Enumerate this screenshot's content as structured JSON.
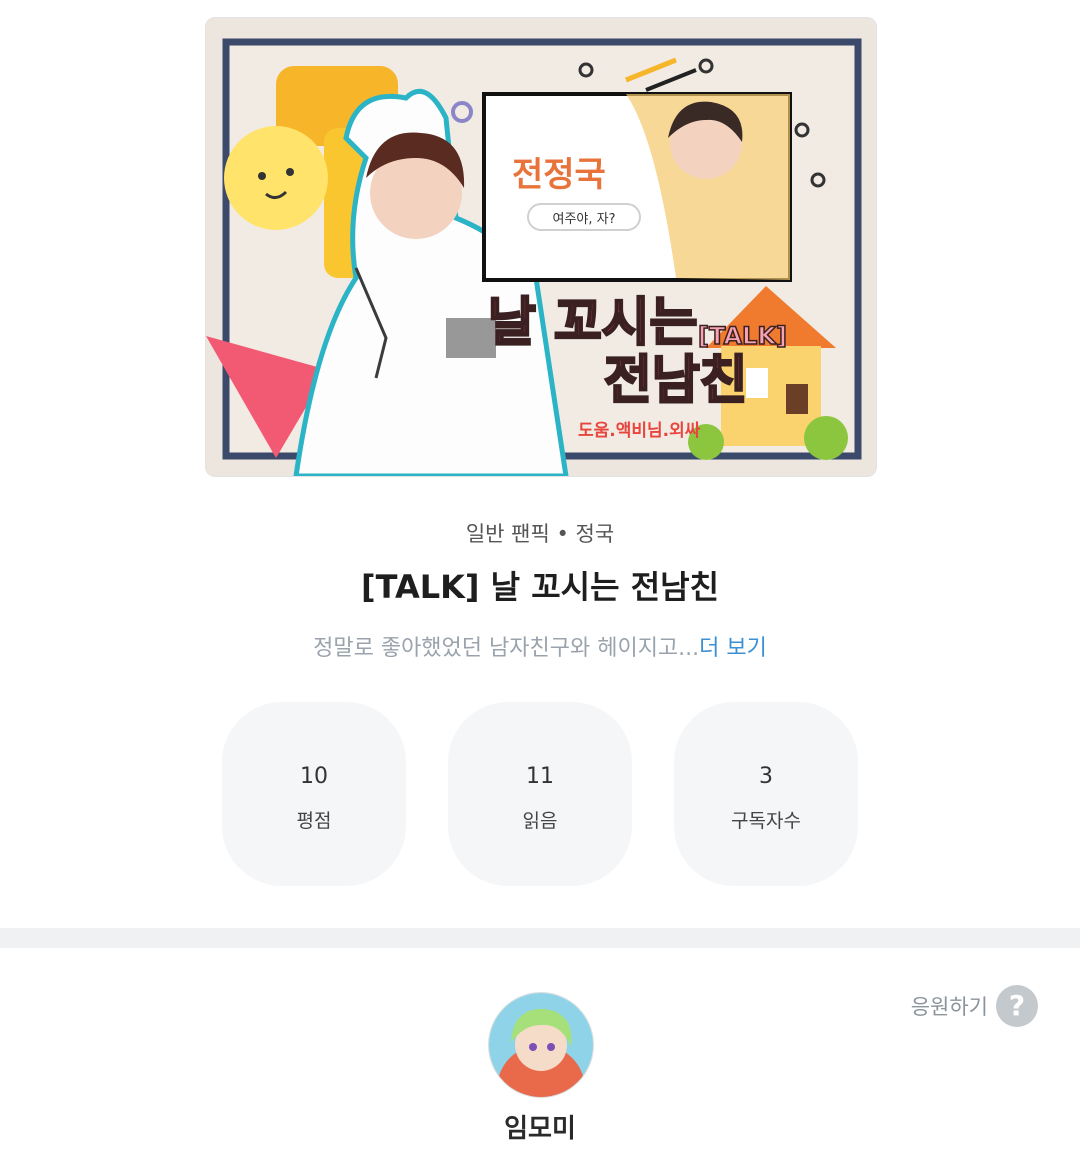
{
  "cover": {
    "name_text": "전정국",
    "bubble_text": "여주야, 자?",
    "title_line1": "날 꼬시는",
    "title_tag": "[TALK]",
    "title_line2": "전남친",
    "credit": "도움.액비님.외싸"
  },
  "work": {
    "category": "일반 팬픽 • 정국",
    "title": "[TALK] 날 꼬시는 전남친",
    "description": "정말로 좋아했었던 남자친구와 헤이지고...",
    "more_label": "더 보기"
  },
  "stats": [
    {
      "value": "10",
      "label": "평점"
    },
    {
      "value": "11",
      "label": "읽음"
    },
    {
      "value": "3",
      "label": "구독자수"
    }
  ],
  "support": {
    "label": "응원하기",
    "help_icon": "question-circle-icon"
  },
  "author": {
    "name": "임모미"
  }
}
